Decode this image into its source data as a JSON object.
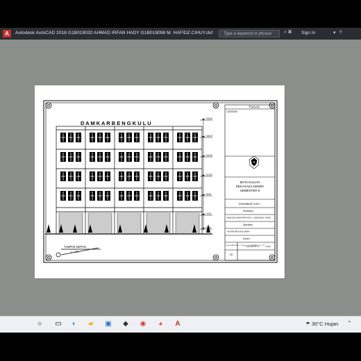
{
  "window": {
    "app_badge": "A",
    "title": "Autodesk AutoCAD 2018    G1B019032 AHMAD IRFAN HADY G1B019098 M. HAFIDZ.CIHUY.dxf",
    "search_placeholder": "Type a keyword or phrase",
    "sign_in": "Sign In"
  },
  "drawing": {
    "building_title": "D A M K A R   B E N G K U L U",
    "view_label": "TAMPAK DEPAN",
    "scale_label": "1 : 200",
    "levels": [
      "+23.00",
      "+18.00",
      "+14.00",
      "+10.00",
      "+6.00",
      "+2.00",
      "±0.00"
    ],
    "title_block": {
      "header": "TUGAS",
      "notes_label": "CATATAN",
      "course_line1": "MATA KULIAH",
      "course_line2": "REKAYASA GEMPA",
      "course_line3": "SEMESTER 5",
      "drawn_by": "DIGAMBAR OLEH :",
      "row1_label": "Kelompok",
      "row1_text": "G1B019032 AHMAD IRFAN HADY / G1B019098 M. HAFIDZ",
      "row2_label": "Diperiksa",
      "row2_text": "ASISTEN REKAYASA GEMPA",
      "row3_label": "Dosen",
      "row3_text": "ELVIS SAPUTRA, S.T., M.Eng / Ir. ROSEMARY, S.T., M.T.",
      "sheet_no": "25",
      "sheet_code": "TGS.RG.III.Y4",
      "sheet_scale": "1:200"
    }
  },
  "taskbar": {
    "weather_temp": "30°C",
    "weather_text": "Hujan"
  },
  "colors": {
    "titlebar": "#2b2d33",
    "workspace": "#8c8e8c",
    "paper": "#ffffff",
    "taskbar": "#eef0f3",
    "accent_red": "#c0322b"
  }
}
